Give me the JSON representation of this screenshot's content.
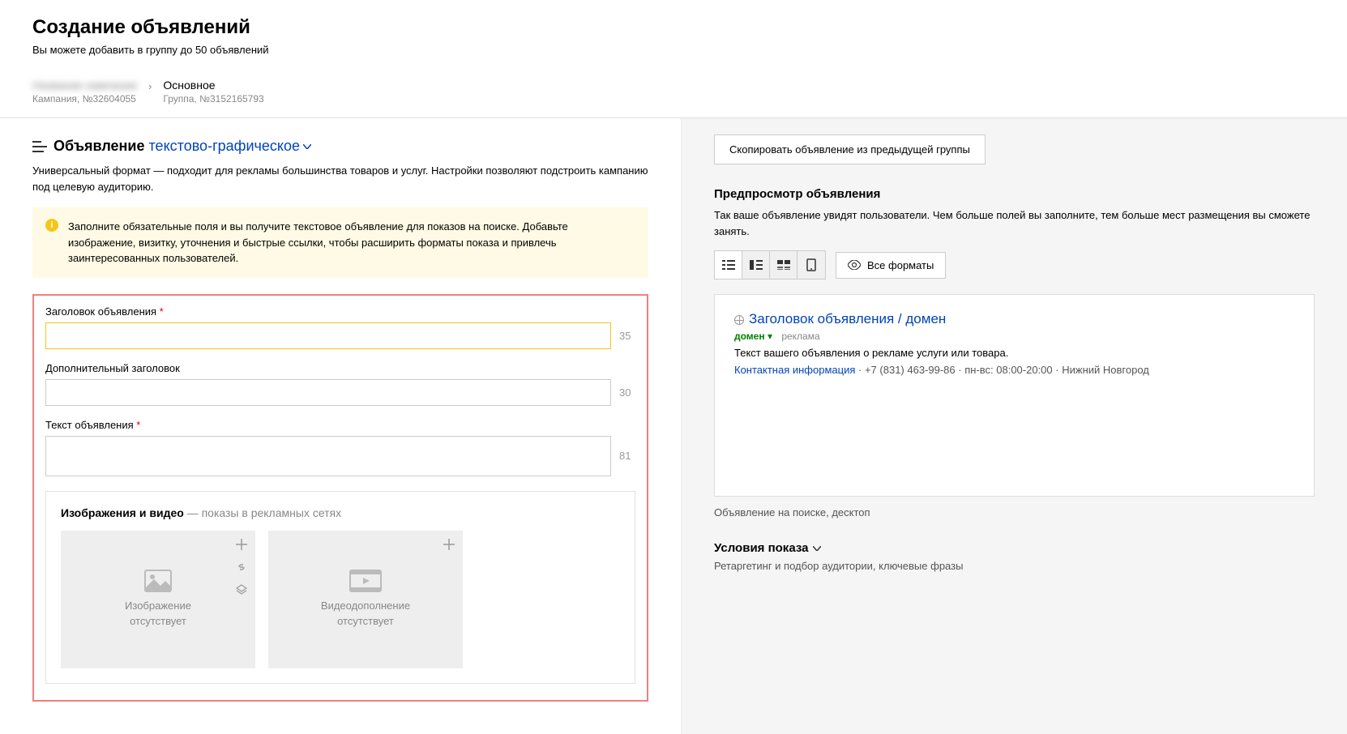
{
  "header": {
    "title": "Создание объявлений",
    "subtitle": "Вы можете добавить в группу до 50 объявлений"
  },
  "breadcrumb": {
    "campaign_name": "Название кампании",
    "campaign_meta": "Кампания, №32604055",
    "group_name": "Основное",
    "group_meta": "Группа, №3152165793"
  },
  "ad_heading": {
    "label": "Объявление",
    "type_link": "текстово-графическое"
  },
  "format_desc": "Универсальный формат — подходит для рекламы большинства товаров и услуг. Настройки позволяют подстроить кампанию под целевую аудиторию.",
  "info_box": "Заполните обязательные поля и вы получите текстовое объявление для показов на поиске. Добавьте изображение, визитку, уточнения и быстрые ссылки, чтобы расширить форматы показа и привлечь заинтересованных пользователей.",
  "fields": {
    "title_label": "Заголовок объявления",
    "title_counter": "35",
    "subtitle_label": "Дополнительный заголовок",
    "subtitle_counter": "30",
    "text_label": "Текст объявления",
    "text_counter": "81"
  },
  "media": {
    "heading": "Изображения и видео",
    "heading_sub": " — показы в рекламных сетях",
    "image_label": "Изображение\nотсутствует",
    "video_label": "Видеодополнение\nотсутствует"
  },
  "right": {
    "copy_btn": "Скопировать объявление из предыдущей группы",
    "preview_title": "Предпросмотр объявления",
    "preview_desc": "Так ваше объявление увидят пользователи. Чем больше полей вы заполните, тем больше мест размещения вы сможете занять.",
    "all_formats": "Все форматы",
    "preview_caption": "Объявление на поиске, десктоп",
    "cond_title": "Условия показа",
    "cond_sub": "Ретаргетинг и подбор аудитории, ключевые фразы"
  },
  "preview_card": {
    "title": "Заголовок объявления / домен",
    "domain": "домен",
    "ad_badge": "реклама",
    "text": "Текст вашего объявления о рекламе услуги или товара.",
    "contact": "Контактная информация",
    "phone": "+7 (831) 463-99-86",
    "hours": "пн-вс: 08:00-20:00",
    "city": "Нижний Новгород"
  }
}
